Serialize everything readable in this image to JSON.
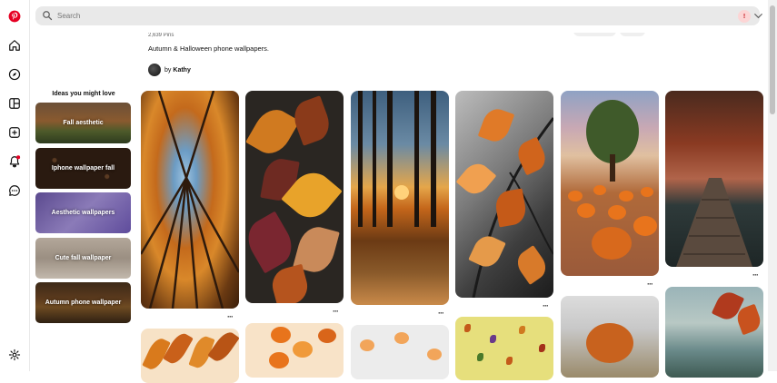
{
  "search": {
    "placeholder": "Search"
  },
  "account": {
    "avatar_initial": "!"
  },
  "board": {
    "pins_count": "2,639 Pins",
    "description": "Autumn & Halloween phone wallpapers.",
    "owner_prefix": "by",
    "owner_name": "Kathy"
  },
  "ideas": {
    "title": "Ideas you might love",
    "items": [
      {
        "label": "Fall aesthetic"
      },
      {
        "label": "Iphone wallpaper fall"
      },
      {
        "label": "Aesthetic wallpapers"
      },
      {
        "label": "Cute fall wallpaper"
      },
      {
        "label": "Autumn phone wallpaper"
      }
    ]
  },
  "colors": {
    "brand": "#e60023",
    "notification": "#e60023",
    "search_bg": "#e9e9e9"
  },
  "sidebar": {
    "icons": [
      "pinterest-logo-icon",
      "home-icon",
      "explore-icon",
      "boards-icon",
      "create-icon",
      "notifications-icon",
      "messages-icon",
      "settings-icon"
    ]
  }
}
